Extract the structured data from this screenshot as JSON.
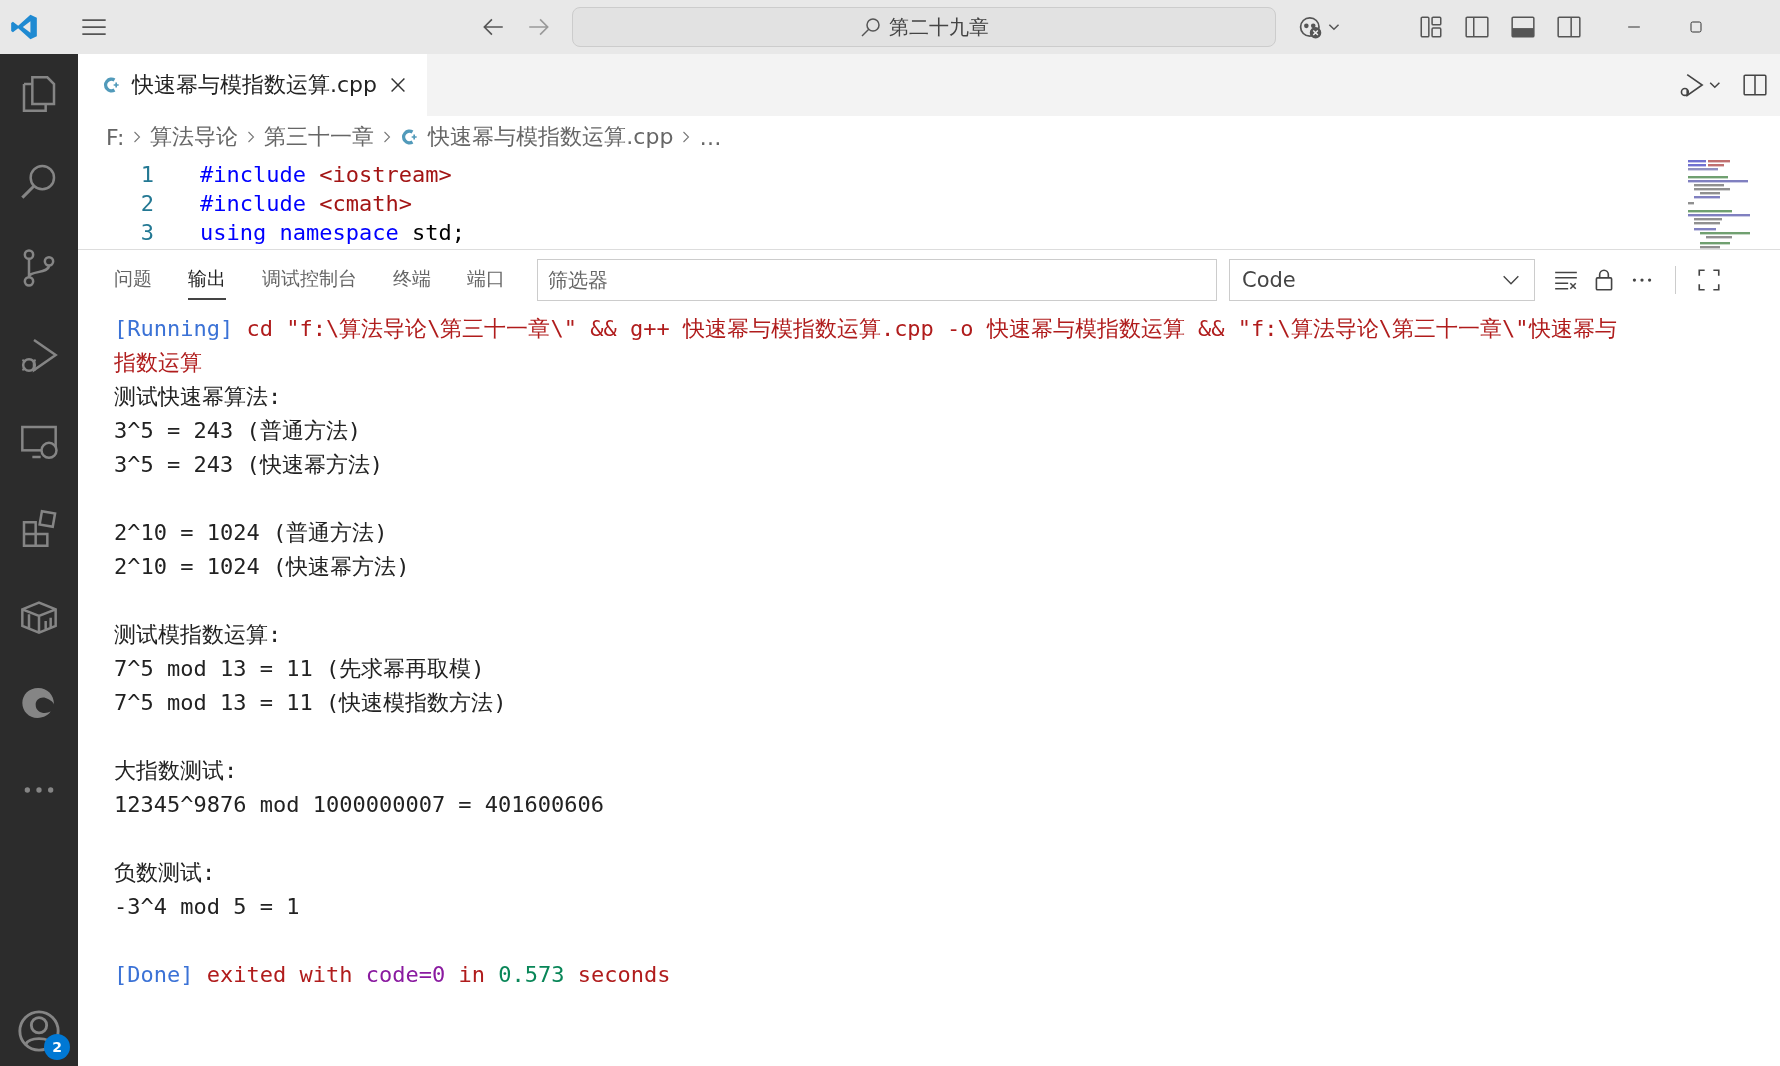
{
  "title_bar": {
    "search": "第二十九章"
  },
  "activity_bar": {
    "account_badge": "2"
  },
  "tabs": [
    {
      "label": "快速幂与模指数运算.cpp",
      "selected": true
    }
  ],
  "breadcrumb": [
    "F:",
    "算法导论",
    "第三十一章",
    "快速幂与模指数运算.cpp",
    "…"
  ],
  "code_lines": [
    {
      "number": "1",
      "tokens": [
        {
          "kind": "directive",
          "text": "#include"
        },
        {
          "kind": "string",
          "text": " <iostream>"
        }
      ]
    },
    {
      "number": "2",
      "tokens": [
        {
          "kind": "directive",
          "text": "#include"
        },
        {
          "kind": "string",
          "text": " <cmath>"
        }
      ]
    },
    {
      "number": "3",
      "tokens": [
        {
          "kind": "keyword",
          "text": "using namespace"
        },
        {
          "kind": "plain",
          "text": " std;"
        }
      ]
    }
  ],
  "panel": {
    "tabs": [
      {
        "label": "问题",
        "selected": false
      },
      {
        "label": "输出",
        "selected": true
      },
      {
        "label": "调试控制台",
        "selected": false
      },
      {
        "label": "终端",
        "selected": false
      },
      {
        "label": "端口",
        "selected": false
      }
    ],
    "filter": {
      "placeholder": "筛选器"
    },
    "channel": "Code",
    "output": [
      {
        "kind": "running",
        "tag": "[Running]",
        "text": "cd \"f:\\算法导论\\第三十一章\\\" && g++ 快速幂与模指数运算.cpp -o 快速幂与模指数运算 && \"f:\\算法导论\\第三十一章\\\"快速幂与",
        "continuation": "指数运算"
      },
      {
        "kind": "plain",
        "text": "测试快速幂算法:"
      },
      {
        "kind": "plain",
        "text": "3^5 = 243 (普通方法)"
      },
      {
        "kind": "plain",
        "text": "3^5 = 243 (快速幂方法)"
      },
      {
        "kind": "blank"
      },
      {
        "kind": "plain",
        "text": "2^10 = 1024 (普通方法)"
      },
      {
        "kind": "plain",
        "text": "2^10 = 1024 (快速幂方法)"
      },
      {
        "kind": "blank"
      },
      {
        "kind": "plain",
        "text": "测试模指数运算:"
      },
      {
        "kind": "plain",
        "text": "7^5 mod 13 = 11 (先求幂再取模)"
      },
      {
        "kind": "plain",
        "text": "7^5 mod 13 = 11 (快速模指数方法)"
      },
      {
        "kind": "blank"
      },
      {
        "kind": "plain",
        "text": "大指数测试:"
      },
      {
        "kind": "plain",
        "text": "12345^9876 mod 1000000007 = 401600606"
      },
      {
        "kind": "blank"
      },
      {
        "kind": "plain",
        "text": "负数测试:"
      },
      {
        "kind": "plain",
        "text": "-3^4 mod 5 = 1"
      },
      {
        "kind": "blank"
      },
      {
        "kind": "done",
        "tag": "[Done]",
        "segments": [
          {
            "kind": "text",
            "text": "exited with"
          },
          {
            "kind": "keyword",
            "text": "code=0"
          },
          {
            "kind": "text",
            "text": "in"
          },
          {
            "kind": "number",
            "text": "0.573"
          },
          {
            "kind": "text",
            "text": "seconds"
          }
        ]
      }
    ]
  }
}
